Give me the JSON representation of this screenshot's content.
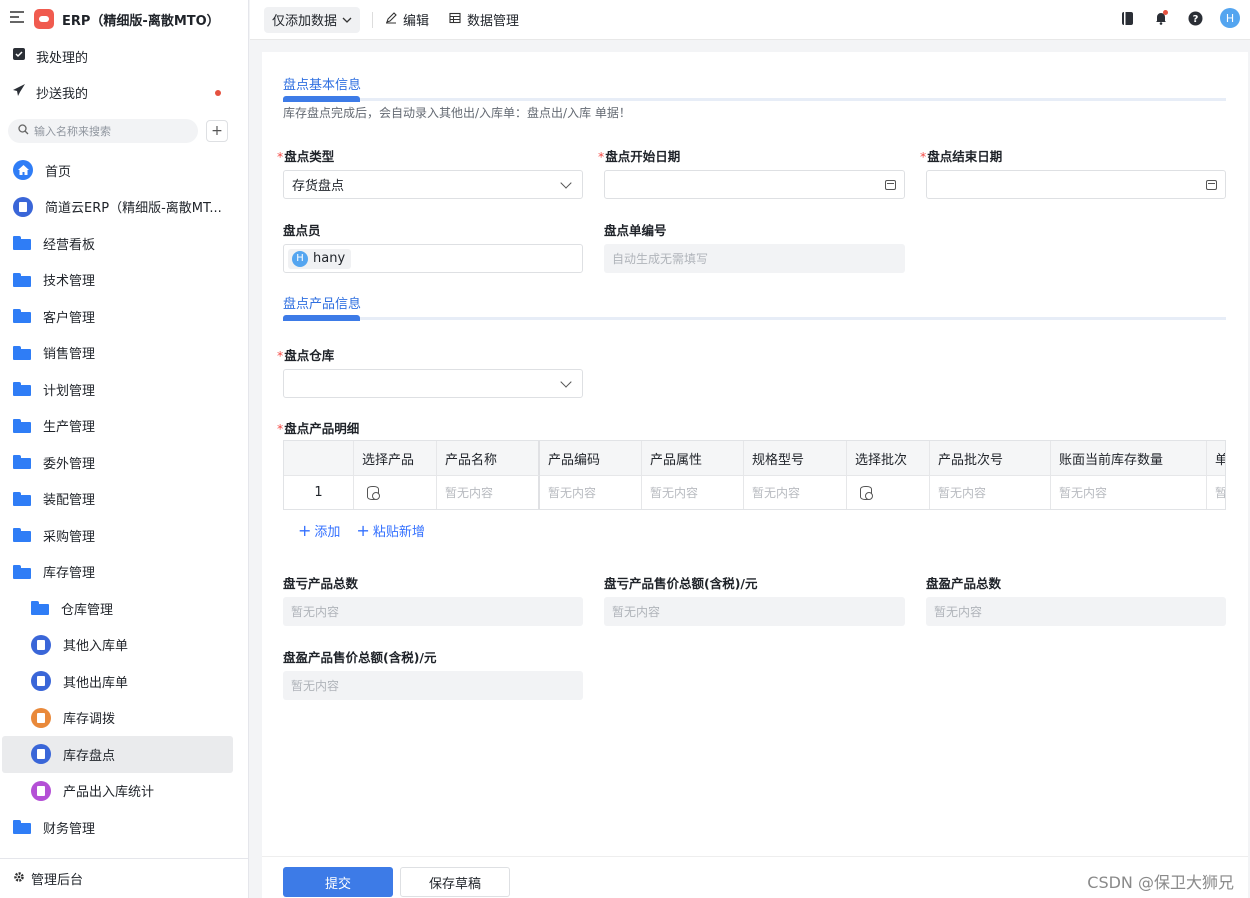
{
  "app": {
    "title": "ERP（精细版-离散MTO）",
    "brand_color": "#3d7be7"
  },
  "sidebar": {
    "top_items": [
      {
        "label": "我处理的",
        "icon": "inbox-check-icon"
      },
      {
        "label": "抄送我的",
        "icon": "paper-plane-icon",
        "unread": true
      }
    ],
    "search_placeholder": "输入名称来搜索",
    "nav": [
      {
        "label": "首页",
        "icon": "home-icon"
      },
      {
        "label": "简道云ERP（精细版-离散MT...",
        "icon": "app-doc-icon"
      },
      {
        "label": "经营看板",
        "icon": "folder-icon"
      },
      {
        "label": "技术管理",
        "icon": "folder-icon"
      },
      {
        "label": "客户管理",
        "icon": "folder-icon"
      },
      {
        "label": "销售管理",
        "icon": "folder-icon"
      },
      {
        "label": "计划管理",
        "icon": "folder-icon"
      },
      {
        "label": "生产管理",
        "icon": "folder-icon"
      },
      {
        "label": "委外管理",
        "icon": "folder-icon"
      },
      {
        "label": "装配管理",
        "icon": "folder-icon"
      },
      {
        "label": "采购管理",
        "icon": "folder-icon"
      },
      {
        "label": "库存管理",
        "icon": "folder-open-icon"
      },
      {
        "label": "仓库管理",
        "icon": "folder-icon"
      },
      {
        "label": "其他入库单",
        "icon": "form-doc-icon"
      },
      {
        "label": "其他出库单",
        "icon": "form-doc-icon"
      },
      {
        "label": "库存调拨",
        "icon": "transfer-icon"
      },
      {
        "label": "库存盘点",
        "icon": "form-doc-icon",
        "active": true
      },
      {
        "label": "产品出入库统计",
        "icon": "chart-board-icon"
      },
      {
        "label": "财务管理",
        "icon": "folder-icon"
      }
    ],
    "footer_label": "管理后台"
  },
  "topbar": {
    "mode_dropdown": "仅添加数据",
    "edit_label": "编辑",
    "data_manage_label": "数据管理",
    "user_initial": "H"
  },
  "form": {
    "section1_title": "盘点基本信息",
    "section1_hint": "库存盘点完成后，会自动录入其他出/入库单：盘点出/入库 单据！",
    "type_label": "盘点类型",
    "type_value": "存货盘点",
    "start_date_label": "盘点开始日期",
    "end_date_label": "盘点结束日期",
    "clerk_label": "盘点员",
    "clerk_initial": "H",
    "clerk_name": "hany",
    "number_label": "盘点单编号",
    "number_placeholder": "自动生成无需填写",
    "section2_title": "盘点产品信息",
    "warehouse_label": "盘点仓库",
    "detail_label": "盘点产品明细",
    "table": {
      "columns": [
        "",
        "选择产品",
        "产品名称",
        "产品编码",
        "产品属性",
        "规格型号",
        "选择批次",
        "产品批次号",
        "账面当前库存数量",
        "单"
      ],
      "row": [
        "1",
        "",
        "暂无内容",
        "暂无内容",
        "暂无内容",
        "暂无内容",
        "",
        "暂无内容",
        "暂无内容",
        "暂"
      ]
    },
    "add_label": "添加",
    "paste_label": "粘贴新增",
    "loss_count_label": "盘亏产品总数",
    "loss_amount_label": "盘亏产品售价总额(含税)/元",
    "gain_count_label": "盘盈产品总数",
    "gain_amount_label": "盘盈产品售价总额(含税)/元",
    "empty_text": "暂无内容"
  },
  "actions": {
    "submit": "提交",
    "save_draft": "保存草稿"
  },
  "watermark": "CSDN @保卫大狮兄"
}
